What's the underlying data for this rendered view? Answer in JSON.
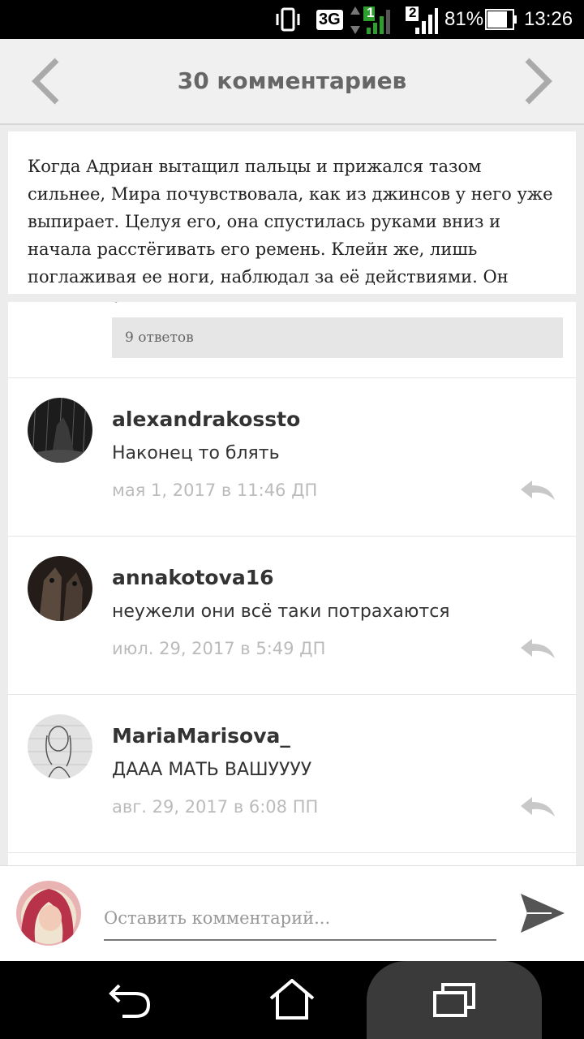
{
  "status_bar": {
    "network": "3G",
    "sim1": "1",
    "sim2": "2",
    "battery": "81%",
    "time": "13:26"
  },
  "header": {
    "title": "30 комментариев"
  },
  "quote": {
    "text": "Когда Адриан вытащил пальцы и прижался тазом сильнее, Мира почувствовала, как из джинсов у него уже выпирает. Целуя его, она спустилась руками вниз и начала расстёгивать его ремень. Клейн же, лишь поглаживая ее ноги, наблюдал за её действиями. Он"
  },
  "replies_button": {
    "label": "9 ответов"
  },
  "comments": [
    {
      "username": "alexandrakossto",
      "text": "Наконец то блять",
      "date": "мая 1, 2017 в 11:46 ДП"
    },
    {
      "username": "annakotova16",
      "text": "неужели они всё таки потрахаются",
      "date": "июл. 29, 2017 в 5:49 ДП"
    },
    {
      "username": "MariaMarisova_",
      "text": "ДААА МАТЬ ВАШУУУУ",
      "date": "авг. 29, 2017 в 6:08 ПП"
    }
  ],
  "composer": {
    "placeholder": "Оставить комментарий..."
  },
  "colors": {
    "header_bg": "#f0f0f0",
    "page_bg": "#ececec",
    "username": "#333333",
    "date": "#bbbbbb"
  },
  "icons": [
    "vibrate-icon",
    "signal-icon",
    "battery-icon",
    "chevron-left-icon",
    "chevron-right-icon",
    "reply-icon",
    "send-icon",
    "back-icon",
    "home-icon",
    "recent-apps-icon"
  ]
}
